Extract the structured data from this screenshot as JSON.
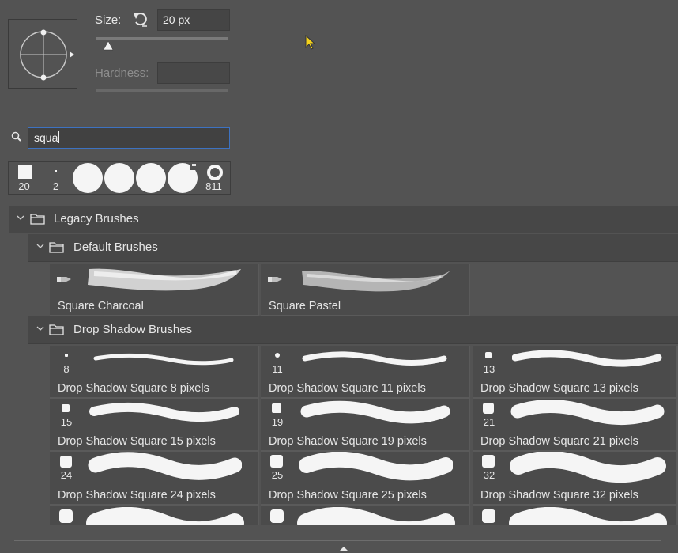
{
  "size": {
    "label": "Size:",
    "value": "20 px",
    "reset_icon": "reset-icon",
    "slider_percent": 7
  },
  "hardness": {
    "label": "Hardness:",
    "value": ""
  },
  "search": {
    "value": "squa",
    "icon": "search-icon"
  },
  "recent_brushes": [
    {
      "size": "20",
      "shape": "square"
    },
    {
      "size": "2",
      "shape": "dot"
    },
    {
      "size": "",
      "shape": "round"
    },
    {
      "size": "",
      "shape": "round"
    },
    {
      "size": "",
      "shape": "round"
    },
    {
      "size": "",
      "shape": "round-clipped"
    },
    {
      "size": "811",
      "shape": "ring"
    }
  ],
  "groups": {
    "legacy": "Legacy Brushes",
    "default": "Default Brushes",
    "drop_shadow": "Drop Shadow Brushes"
  },
  "default_brushes": [
    {
      "name": "Square Charcoal"
    },
    {
      "name": "Square Pastel"
    }
  ],
  "drop_shadow_brushes": [
    {
      "size": "8",
      "name": "Drop Shadow Square 8 pixels"
    },
    {
      "size": "11",
      "name": "Drop Shadow Square 11 pixels"
    },
    {
      "size": "13",
      "name": "Drop Shadow Square 13 pixels"
    },
    {
      "size": "15",
      "name": "Drop Shadow Square 15 pixels"
    },
    {
      "size": "19",
      "name": "Drop Shadow Square 19 pixels"
    },
    {
      "size": "21",
      "name": "Drop Shadow Square 21 pixels"
    },
    {
      "size": "24",
      "name": "Drop Shadow Square 24 pixels"
    },
    {
      "size": "25",
      "name": "Drop Shadow Square 25 pixels"
    },
    {
      "size": "32",
      "name": "Drop Shadow Square 32 pixels"
    },
    {
      "size": "",
      "name": ""
    },
    {
      "size": "",
      "name": ""
    },
    {
      "size": "",
      "name": ""
    }
  ]
}
